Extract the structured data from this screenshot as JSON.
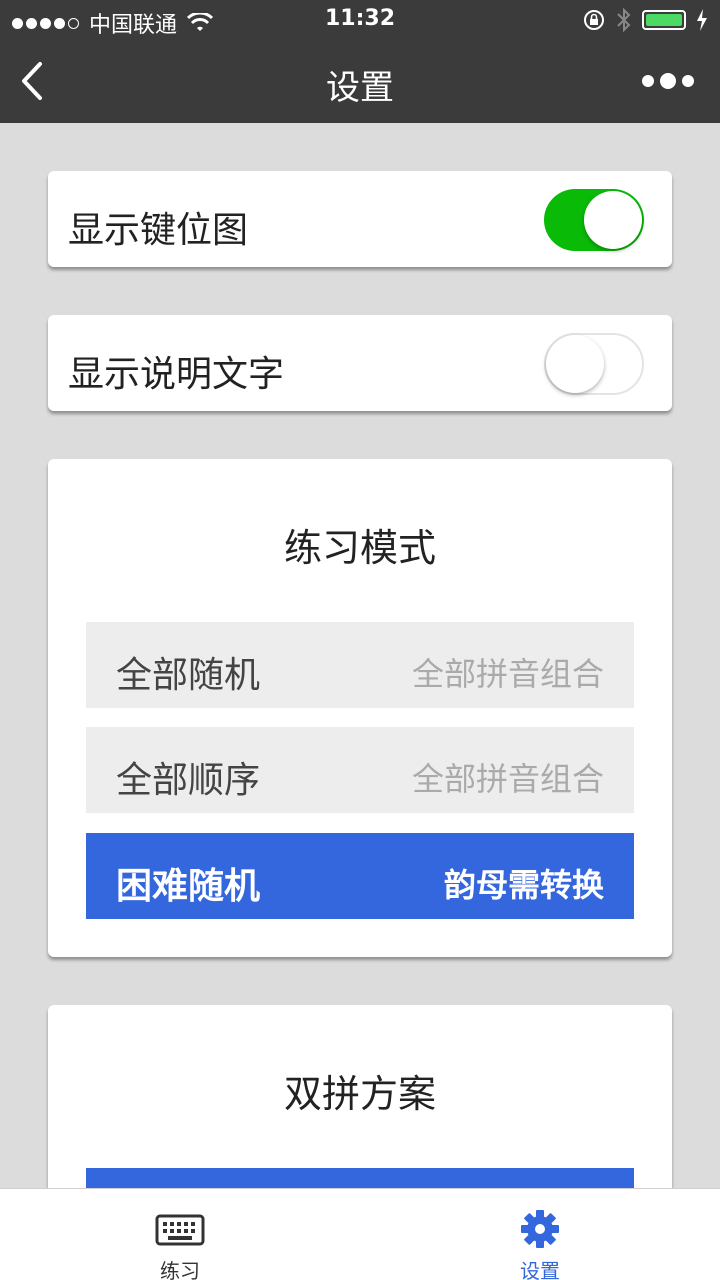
{
  "status_bar": {
    "carrier": "中国联通",
    "time": "11:32"
  },
  "nav": {
    "title": "设置"
  },
  "toggles": [
    {
      "label": "显示键位图",
      "on": true
    },
    {
      "label": "显示说明文字",
      "on": false
    }
  ],
  "practice_mode": {
    "title": "练习模式",
    "options": [
      {
        "label": "全部随机",
        "desc": "全部拼音组合",
        "selected": false
      },
      {
        "label": "全部顺序",
        "desc": "全部拼音组合",
        "selected": false
      },
      {
        "label": "困难随机",
        "desc": "韵母需转换",
        "selected": true
      }
    ]
  },
  "scheme": {
    "title": "双拼方案"
  },
  "tabbar": {
    "tabs": [
      {
        "label": "练习",
        "icon": "keyboard-icon",
        "active": false
      },
      {
        "label": "设置",
        "icon": "gear-icon",
        "active": true
      }
    ]
  },
  "colors": {
    "accent": "#3466de",
    "switch_on": "#09bb07",
    "bar": "#3b3b3b"
  }
}
